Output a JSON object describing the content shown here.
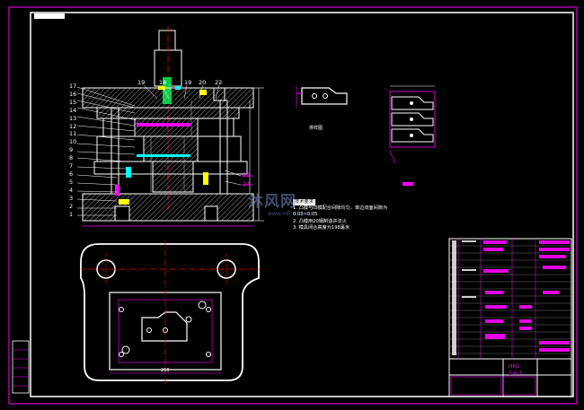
{
  "drawing": {
    "part_numbers_left": [
      "17",
      "16",
      "15",
      "14",
      "13",
      "12",
      "11",
      "10",
      "9",
      "8",
      "7",
      "6",
      "5",
      "4",
      "3",
      "2",
      "1"
    ],
    "part_numbers_top": [
      "19",
      "18",
      "19",
      "20",
      "22"
    ],
    "part_numbers_right": [
      "23",
      "24"
    ],
    "detail_label": "排样图",
    "dimension_bottom": "260",
    "tech_notes": {
      "heading": "技术要求",
      "line1": "1. 凸模与凹模配合间隙均匀，单边双面间隙为",
      "line2": "0.03~0.05",
      "line3": "2. 凸模用20钢制造并淬火",
      "line4": "3. 模具闭合高度为198毫米"
    },
    "title_block": {
      "drawing_no": "HK2",
      "ratio": "1:0.7"
    },
    "watermark": "沐风网",
    "watermark_url": "www.mfcad.com"
  },
  "colors": {
    "background": "#000000",
    "border": "#ffffff",
    "accent": "#ff00ff",
    "center_line": "#ff0000",
    "hatch": "#c0c0c0"
  }
}
